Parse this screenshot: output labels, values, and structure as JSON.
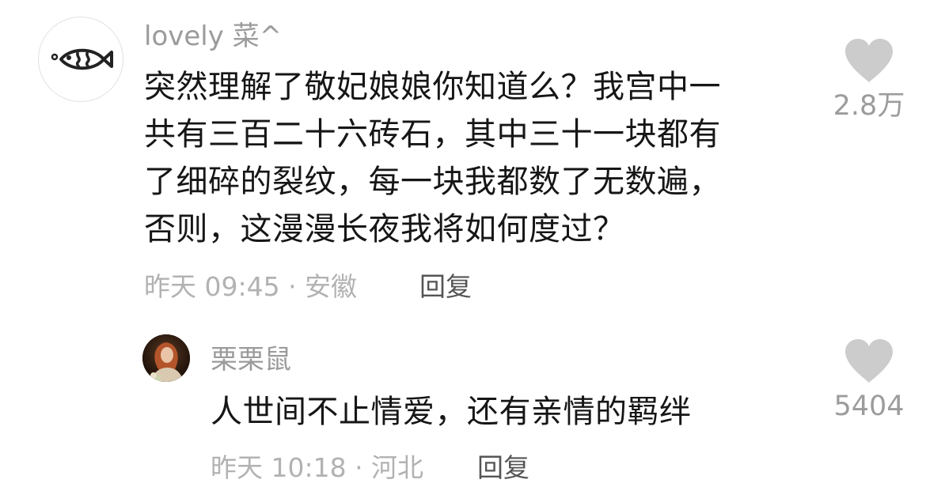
{
  "comments": [
    {
      "username": "lovely 菜^",
      "avatar_icon": "fish-icon",
      "lines": [
        "突然理解了敬妃娘娘你知道么？我宫中一",
        "共有三百二十六砖石，其中三十一块都有",
        "了细碎的裂纹，每一块我都数了无数遍，",
        "否则，这漫漫长夜我将如何度过？"
      ],
      "meta": "昨天 09:45 · 安徽",
      "reply_label": "回复",
      "likes": "2.8万"
    }
  ],
  "replies": [
    {
      "username": "栗栗鼠",
      "text": "人世间不止情爱，还有亲情的羁绊",
      "meta": "昨天 10:18 · 河北",
      "reply_label": "回复",
      "likes": "5404"
    }
  ],
  "colors": {
    "heart": "#cccccc",
    "username": "#9b9b9b",
    "meta": "#b2b2b2",
    "text": "#161616"
  }
}
